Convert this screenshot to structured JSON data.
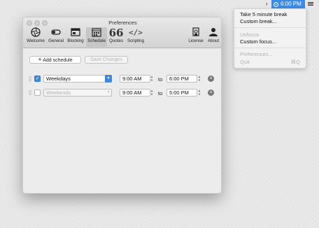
{
  "menubar": {
    "arrow": "‹",
    "time": "6:00 PM",
    "time_icon": "clock-icon",
    "list_icon": "list-icon"
  },
  "menu": {
    "items": [
      {
        "label": "Take 5 minute break",
        "enabled": true
      },
      {
        "label": "Custom break...",
        "enabled": true
      },
      {
        "label": "Unfocus",
        "enabled": false
      },
      {
        "label": "Custom focus...",
        "enabled": true
      },
      {
        "label": "Preferences...",
        "enabled": false
      },
      {
        "label": "Quit",
        "enabled": false,
        "shortcut": "⌘Q"
      }
    ]
  },
  "window": {
    "title": "Preferences",
    "toolbar": [
      {
        "label": "Welcome",
        "icon": "aperture-icon",
        "selected": false
      },
      {
        "label": "General",
        "icon": "switch-icon",
        "selected": false
      },
      {
        "label": "Blocking",
        "icon": "browser-icon",
        "selected": false
      },
      {
        "label": "Schedule",
        "icon": "calendar-icon",
        "selected": true
      },
      {
        "label": "Quotes",
        "icon": "quote-icon",
        "selected": false
      },
      {
        "label": "Scripting",
        "icon": "code-icon",
        "selected": false
      },
      {
        "label": "License",
        "icon": "certificate-icon",
        "selected": false
      },
      {
        "label": "About",
        "icon": "person-icon",
        "selected": false
      }
    ],
    "add_schedule_label": "Add schedule",
    "save_changes_label": "Save Changes",
    "schedules": [
      {
        "enabled": true,
        "days": "Weekdays",
        "start": "9:00 AM",
        "to": "to",
        "end": "6:00 PM"
      },
      {
        "enabled": false,
        "days": "Weekends",
        "start": "9:00 AM",
        "to": "to",
        "end": "5:00 PM"
      }
    ]
  }
}
